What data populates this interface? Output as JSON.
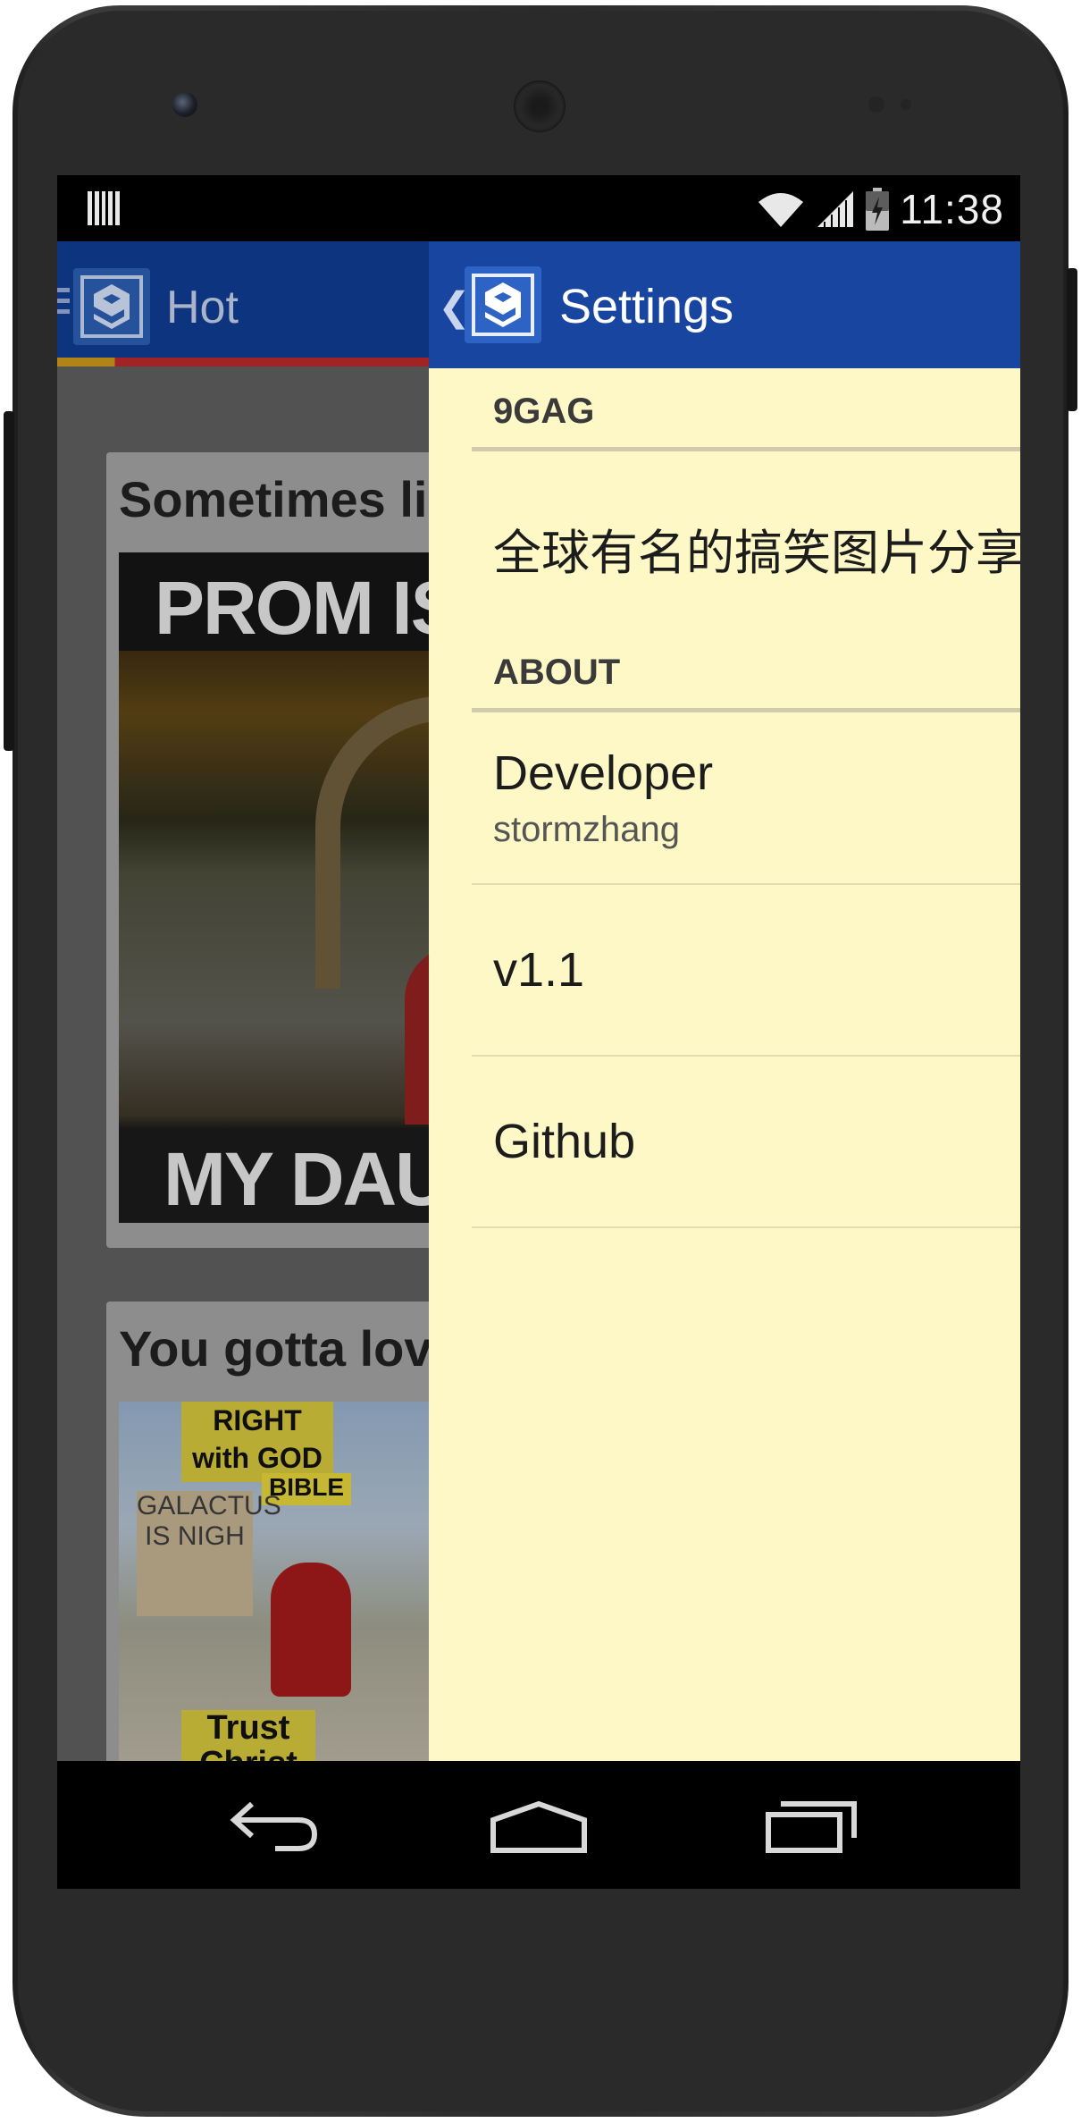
{
  "status_bar": {
    "time": "11:38"
  },
  "background_app": {
    "title": "Hot",
    "cards": [
      {
        "title": "Sometimes li",
        "image_top_text": "PROM IS",
        "image_bottom_text": "MY DAUG"
      },
      {
        "title": "You gotta lov",
        "sign_1": "RIGHT with GOD",
        "sign_2": "BIBLE",
        "sign_3": "GALACTUS IS NIGH",
        "sign_4": "Trust Christ"
      }
    ]
  },
  "drawer": {
    "title": "Settings",
    "sections": [
      {
        "header": "9GAG"
      },
      {
        "header": "ABOUT"
      }
    ],
    "rows": {
      "description": "全球有名的搞笑图片分享",
      "developer_label": "Developer",
      "developer_name": "stormzhang",
      "version": "v1.1",
      "github": "Github"
    }
  },
  "colors": {
    "drawer_background": "#fdf8c6",
    "drawer_bar": "#1845a0",
    "app_bar": "#0f3a8a"
  }
}
